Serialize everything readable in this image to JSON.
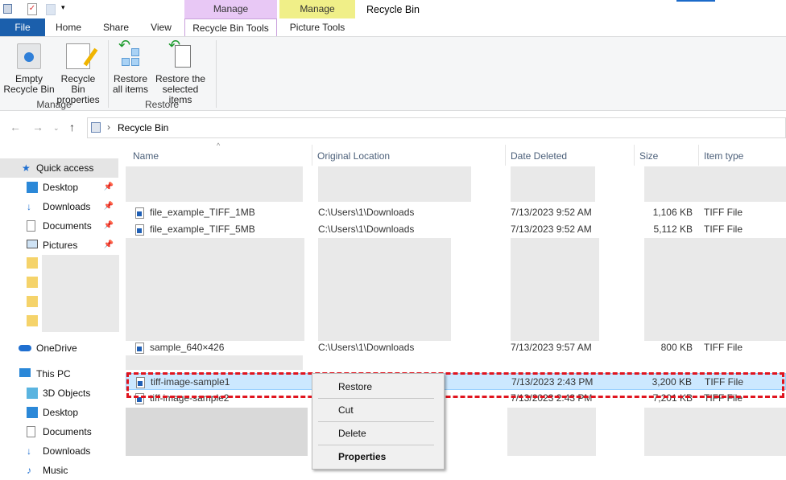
{
  "window": {
    "title": "Recycle Bin"
  },
  "ribbon_tabs": {
    "file": "File",
    "home": "Home",
    "share": "Share",
    "view": "View",
    "context1_header": "Manage",
    "context1_tab": "Recycle Bin Tools",
    "context2_header": "Manage",
    "context2_tab": "Picture Tools"
  },
  "ribbon": {
    "empty_line1": "Empty",
    "empty_line2": "Recycle Bin",
    "props_line1": "Recycle Bin",
    "props_line2": "properties",
    "restore_all_line1": "Restore",
    "restore_all_line2": "all items",
    "restore_sel_line1": "Restore the",
    "restore_sel_line2": "selected items",
    "group_manage": "Manage",
    "group_restore": "Restore"
  },
  "address": {
    "path": "Recycle Bin"
  },
  "sidebar": {
    "quick_access": "Quick access",
    "desktop": "Desktop",
    "downloads": "Downloads",
    "documents": "Documents",
    "pictures": "Pictures",
    "onedrive": "OneDrive",
    "this_pc": "This PC",
    "objects3d": "3D Objects",
    "desktop2": "Desktop",
    "documents2": "Documents",
    "downloads2": "Downloads",
    "music": "Music"
  },
  "columns": {
    "name": "Name",
    "location": "Original Location",
    "date": "Date Deleted",
    "size": "Size",
    "type": "Item type"
  },
  "files": [
    {
      "name": "file_example_TIFF_1MB",
      "location": "C:\\Users\\1\\Downloads",
      "date": "7/13/2023 9:52 AM",
      "size": "1,106 KB",
      "type": "TIFF File"
    },
    {
      "name": "file_example_TIFF_5MB",
      "location": "C:\\Users\\1\\Downloads",
      "date": "7/13/2023 9:52 AM",
      "size": "5,112 KB",
      "type": "TIFF File"
    },
    {
      "name": "sample_640×426",
      "location": "C:\\Users\\1\\Downloads",
      "date": "7/13/2023 9:57 AM",
      "size": "800 KB",
      "type": "TIFF File"
    },
    {
      "name": "tiff-image-sample1",
      "location": "",
      "date": "7/13/2023 2:43 PM",
      "size": "3,200 KB",
      "type": "TIFF File"
    },
    {
      "name": "tiff-image-sample2",
      "location": "",
      "date": "7/13/2023 2:43 PM",
      "size": "7,201 KB",
      "type": "TIFF File"
    }
  ],
  "context_menu": {
    "restore": "Restore",
    "cut": "Cut",
    "delete": "Delete",
    "properties": "Properties"
  },
  "colors": {
    "selection": "#cce8ff",
    "highlight": "#e0141e",
    "file_tab": "#1b5fac"
  }
}
